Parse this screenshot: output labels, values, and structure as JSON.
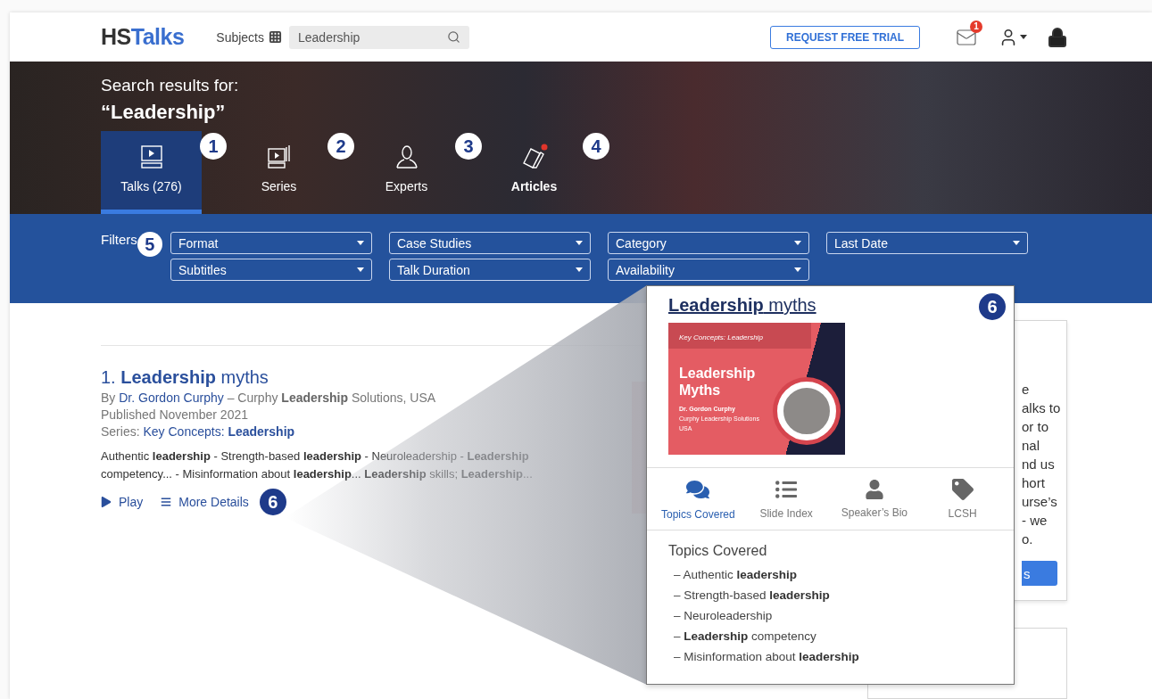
{
  "header": {
    "logo": {
      "dark": "HS",
      "accent": "Talks"
    },
    "subjects": "Subjects",
    "search": {
      "value": "Leadership"
    },
    "trial_button": "REQUEST FREE TRIAL",
    "mail_badge": "1"
  },
  "hero": {
    "caption": "Search results for:",
    "query": "“Leadership”",
    "tabs": [
      {
        "label": "Talks (276)",
        "kind": "talk",
        "selected": true,
        "highlighted": false,
        "callout": "1"
      },
      {
        "label": "Series",
        "kind": "series",
        "selected": false,
        "highlighted": false,
        "callout": "2"
      },
      {
        "label": "Experts",
        "kind": "expert",
        "selected": false,
        "highlighted": false,
        "callout": "3"
      },
      {
        "label": "Articles",
        "kind": "article",
        "selected": false,
        "highlighted": true,
        "callout": "4"
      }
    ]
  },
  "filters": {
    "label": "Filters",
    "callout": "5",
    "rows": [
      [
        "Format",
        "Case Studies",
        "Category",
        "Last Date"
      ],
      [
        "Subtitles",
        "Talk Duration",
        "Availability"
      ]
    ]
  },
  "result": {
    "number": "1.",
    "title": "**Leadership** myths",
    "by": "By",
    "author": "Dr. Gordon Curphy",
    "affiliation": "– Curphy **Leadership** Solutions, USA",
    "published": "Published November 2021",
    "series_label": "Series:",
    "series": "Key Concepts: **Leadership**",
    "snippet": "Authentic **leadership** - Strength-based **leadership** - Neuroleadership - **Leadership** competency... - Misinformation about **leadership**... **Leadership** skills; **Leadership**...",
    "play": "Play",
    "details": "More Details",
    "callout": "6"
  },
  "popup": {
    "title": "**Leadership** myths",
    "callout": "6",
    "thumbnail": {
      "series": "Key Concepts: Leadership",
      "title_lines": [
        "Leadership",
        "Myths"
      ],
      "speaker": "Dr. Gordon Curphy",
      "org": "Curphy Leadership Solutions",
      "country": "USA"
    },
    "tabs": [
      {
        "label": "Topics Covered",
        "kind": "topics",
        "selected": true
      },
      {
        "label": "Slide Index",
        "kind": "slides",
        "selected": false
      },
      {
        "label": "Speaker’s Bio",
        "kind": "bio",
        "selected": false
      },
      {
        "label": "LCSH",
        "kind": "lcsh",
        "selected": false
      }
    ],
    "section_title": "Topics Covered",
    "topics": [
      "– Authentic **leadership**",
      "– Strength-based **leadership**",
      "– Neuroleadership",
      "– **Leadership** competency",
      "– Misinformation about **leadership**"
    ]
  },
  "side_card": {
    "lines": [
      "e",
      "alks to",
      "or to",
      "nal",
      "nd us",
      "hort",
      "urse’s",
      "- we",
      "o."
    ],
    "button": "s"
  }
}
